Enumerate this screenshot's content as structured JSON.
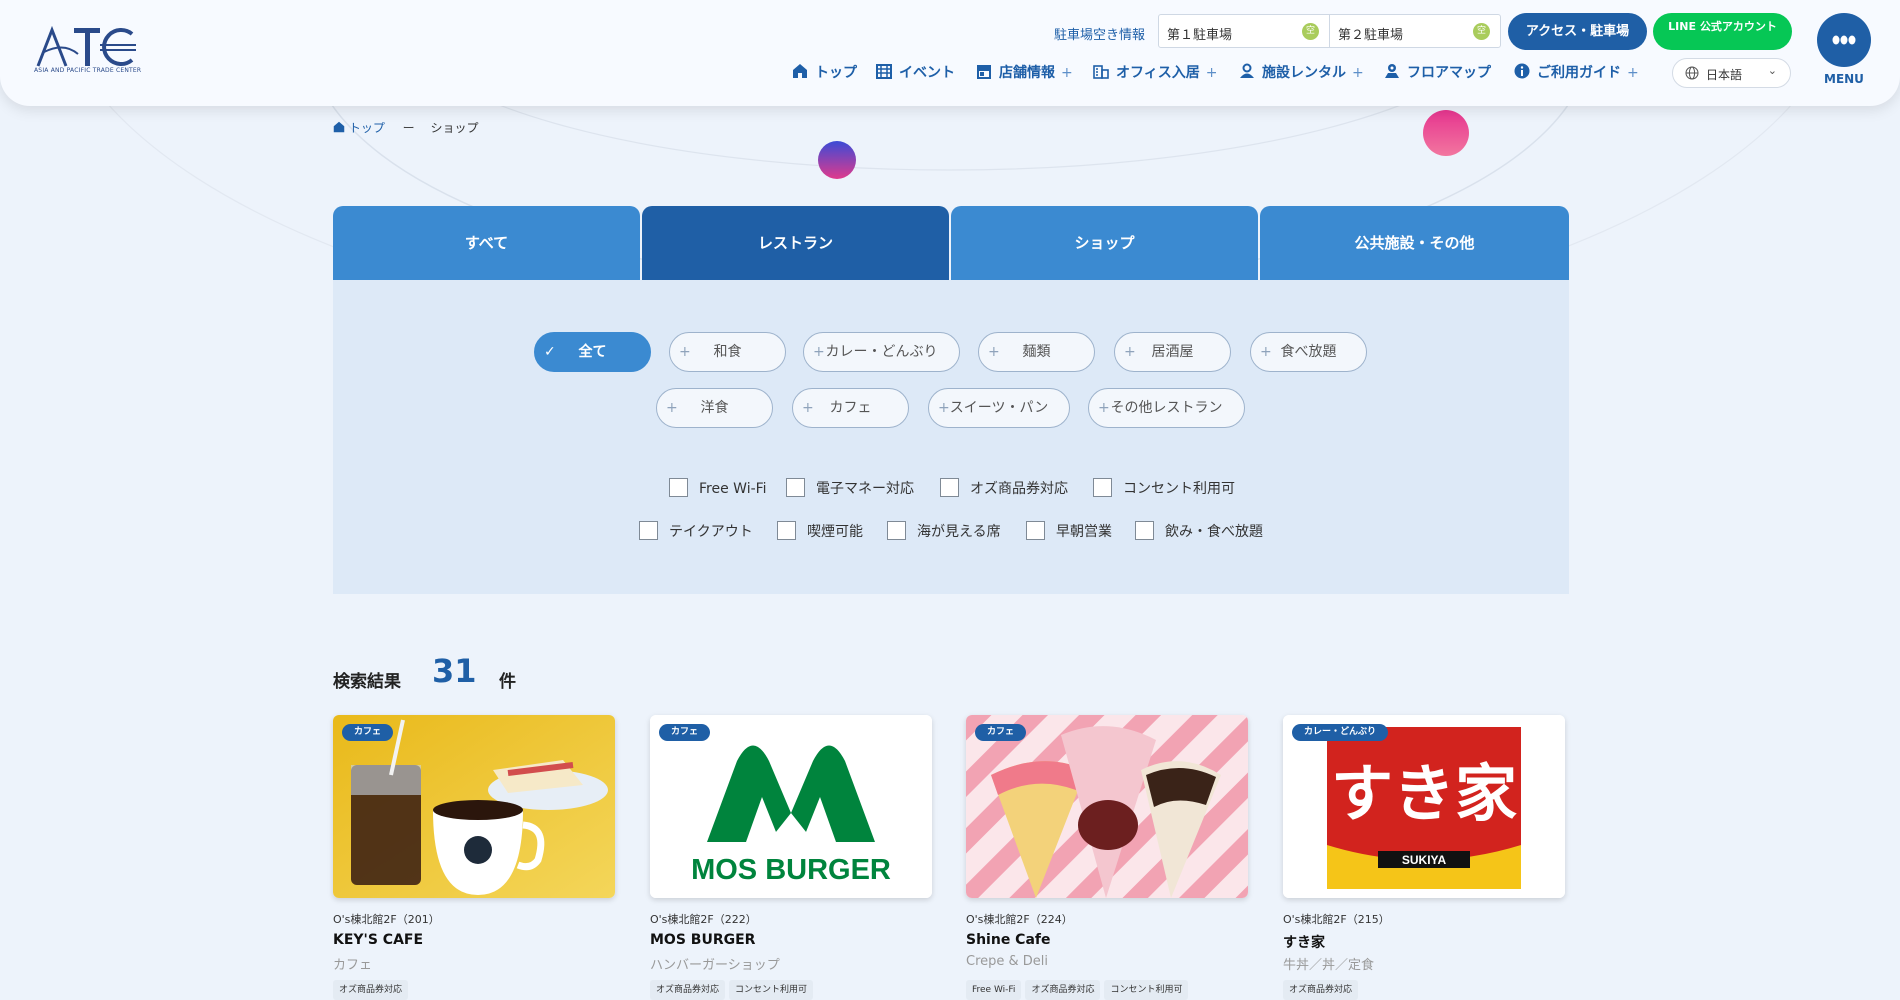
{
  "header": {
    "logo_text": "ATC",
    "logo_sub": "ASIA AND PACIFIC TRADE CENTER",
    "parking_label": "駐車場空き情報",
    "parking": [
      {
        "name": "第１駐車場",
        "status": "空"
      },
      {
        "name": "第２駐車場",
        "status": "空"
      }
    ],
    "access_button": "アクセス・駐車場",
    "line_button": "LINE 公式アカウント",
    "menu_label": "MENU",
    "language": "日本語",
    "nav": [
      {
        "label": "トップ",
        "icon": "home-icon",
        "plus": ""
      },
      {
        "label": "イベント",
        "icon": "calendar-icon",
        "plus": ""
      },
      {
        "label": "店舗情報",
        "icon": "store-icon",
        "plus": "+"
      },
      {
        "label": "オフィス入居",
        "icon": "office-icon",
        "plus": "+"
      },
      {
        "label": "施設レンタル",
        "icon": "person-icon",
        "plus": "+"
      },
      {
        "label": "フロアマップ",
        "icon": "map-pin-icon",
        "plus": ""
      },
      {
        "label": "ご利用ガイド",
        "icon": "info-icon",
        "plus": "+"
      }
    ]
  },
  "breadcrumb": {
    "home": "トップ",
    "sep": "ー",
    "current": "ショップ"
  },
  "tabs": [
    {
      "label": "すべて",
      "active": false
    },
    {
      "label": "レストラン",
      "active": true
    },
    {
      "label": "ショップ",
      "active": false
    },
    {
      "label": "公共施設・その他",
      "active": false
    }
  ],
  "subcategories": {
    "row1": [
      "全て",
      "和食",
      "カレー・どんぶり",
      "麺類",
      "居酒屋",
      "食べ放題"
    ],
    "row2": [
      "洋食",
      "カフェ",
      "スイーツ・パン",
      "その他レストラン"
    ],
    "active": "全て"
  },
  "features": {
    "row1": [
      "Free Wi-Fi",
      "電子マネー対応",
      "オズ商品券対応",
      "コンセント利用可"
    ],
    "row2": [
      "テイクアウト",
      "喫煙可能",
      "海が見える席",
      "早朝営業",
      "飲み・食べ放題"
    ]
  },
  "results": {
    "title": "検索結果",
    "count": "31",
    "unit": "件"
  },
  "shops": [
    {
      "badge": "カフェ",
      "location": "O's棟北館2F（201）",
      "name": "KEY'S CAFE",
      "genre": "カフェ",
      "tags": [
        "オズ商品券対応"
      ]
    },
    {
      "badge": "カフェ",
      "location": "O's棟北館2F（222）",
      "name": "MOS BURGER",
      "genre": "ハンバーガーショップ",
      "tags": [
        "オズ商品券対応",
        "コンセント利用可"
      ],
      "logo_text": "MOS BURGER"
    },
    {
      "badge": "カフェ",
      "location": "O's棟北館2F（224）",
      "name": "Shine Cafe",
      "genre": "Crepe & Deli",
      "tags": [
        "Free Wi-Fi",
        "オズ商品券対応",
        "コンセント利用可"
      ]
    },
    {
      "badge": "カレー・どんぶり",
      "location": "O's棟北館2F（215）",
      "name": "すき家",
      "genre": "牛丼／丼／定食",
      "tags": [
        "オズ商品券対応"
      ],
      "logo_text": "すき家",
      "logo_sub": "SUKIYA"
    }
  ],
  "colors": {
    "primary": "#1f5fa6",
    "tab": "#3b8ad1",
    "line": "#06c755",
    "panel": "#dde9f7"
  }
}
